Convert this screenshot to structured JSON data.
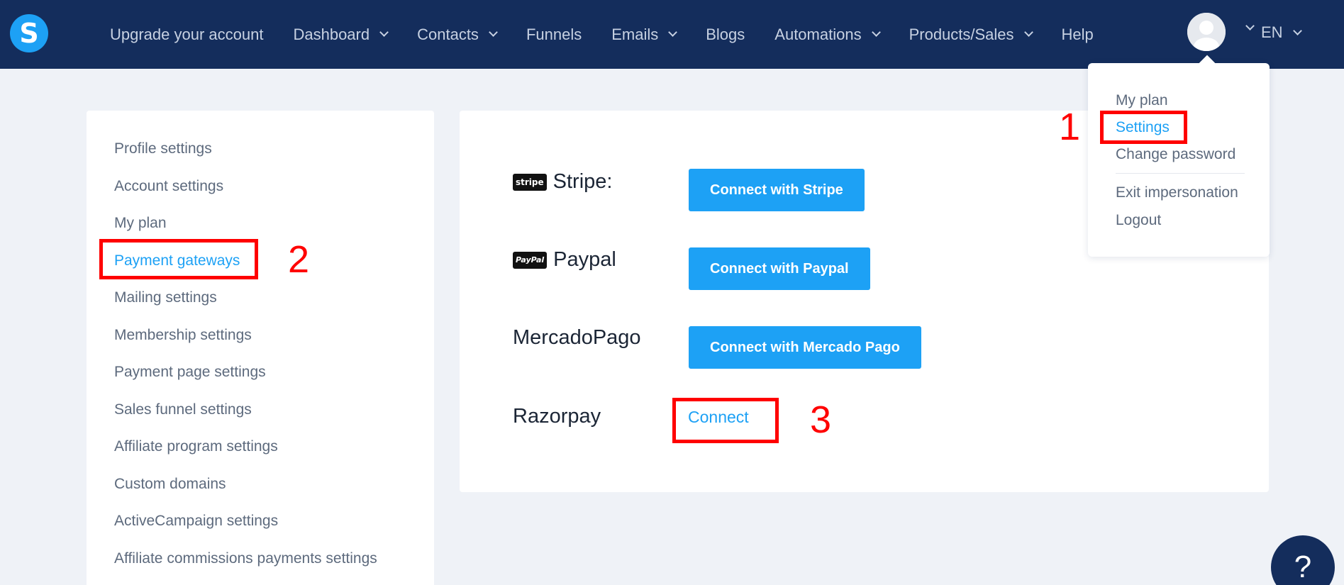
{
  "app": {
    "logo_letter": "S"
  },
  "nav": {
    "items": [
      {
        "label": "Upgrade your account",
        "dropdown": false
      },
      {
        "label": "Dashboard",
        "dropdown": true
      },
      {
        "label": "Contacts",
        "dropdown": true
      },
      {
        "label": "Funnels",
        "dropdown": false
      },
      {
        "label": "Emails",
        "dropdown": true
      },
      {
        "label": "Blogs",
        "dropdown": false
      },
      {
        "label": "Automations",
        "dropdown": true
      },
      {
        "label": "Products/Sales",
        "dropdown": true
      },
      {
        "label": "Help",
        "dropdown": false
      }
    ],
    "language": "EN"
  },
  "account_menu": {
    "items": [
      {
        "label": "My plan"
      },
      {
        "label": "Settings"
      },
      {
        "label": "Change password"
      },
      {
        "label": "Exit impersonation"
      },
      {
        "label": "Logout"
      }
    ],
    "active": "Settings"
  },
  "settings_menu": {
    "items": [
      {
        "label": "Profile settings"
      },
      {
        "label": "Account settings"
      },
      {
        "label": "My plan"
      },
      {
        "label": "Payment gateways"
      },
      {
        "label": "Mailing settings"
      },
      {
        "label": "Membership settings"
      },
      {
        "label": "Payment page settings"
      },
      {
        "label": "Sales funnel settings"
      },
      {
        "label": "Affiliate program settings"
      },
      {
        "label": "Custom domains"
      },
      {
        "label": "ActiveCampaign settings"
      },
      {
        "label": "Affiliate commissions payments settings"
      }
    ],
    "active": "Payment gateways"
  },
  "gateways": {
    "stripe": {
      "badge": "stripe",
      "name": "Stripe:",
      "button": "Connect with Stripe"
    },
    "paypal": {
      "badge": "PayPal",
      "name": "Paypal",
      "button": "Connect with Paypal"
    },
    "mercadopago": {
      "name": "MercadoPago",
      "button": "Connect with Mercado Pago"
    },
    "razorpay": {
      "name": "Razorpay",
      "link": "Connect"
    }
  },
  "annotations": {
    "step1": "1",
    "step2": "2",
    "step3": "3"
  },
  "help": {
    "label": "?"
  },
  "colors": {
    "nav_bg": "#142d5c",
    "accent": "#1da1f5",
    "annotation": "#ff0000"
  }
}
